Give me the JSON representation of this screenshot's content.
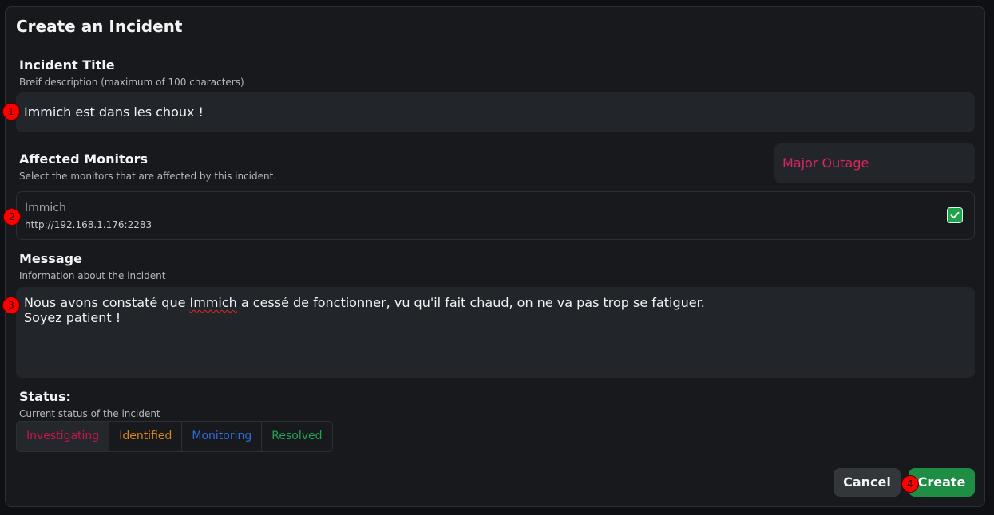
{
  "dialog": {
    "title": "Create an Incident"
  },
  "incident_title": {
    "label": "Incident Title",
    "hint": "Breif description (maximum of 100 characters)",
    "value": "Immich est dans les choux !"
  },
  "monitors": {
    "label": "Affected Monitors",
    "hint": "Select the monitors that are affected by this incident.",
    "impact_value": "Major Outage",
    "items": [
      {
        "name": "Immich",
        "url": "http://192.168.1.176:2283",
        "checked": true
      }
    ]
  },
  "message": {
    "label": "Message",
    "hint": "Information about the incident",
    "line1_before": "Nous avons constaté que ",
    "line1_misspelled": "Immich",
    "line1_after": " a cessé de fonctionner, vu qu'il fait chaud, on ne va pas trop se fatiguer.",
    "line2": "Soyez patient !"
  },
  "status": {
    "label": "Status:",
    "hint": "Current status of the incident",
    "options": [
      {
        "label": "Investigating",
        "color": "#c7174b",
        "selected": true
      },
      {
        "label": "Identified",
        "color": "#d9861a",
        "selected": false
      },
      {
        "label": "Monitoring",
        "color": "#2f6fdc",
        "selected": false
      },
      {
        "label": "Resolved",
        "color": "#22a355",
        "selected": false
      }
    ]
  },
  "actions": {
    "cancel": "Cancel",
    "create": "Create"
  },
  "markers": [
    "1",
    "2",
    "3",
    "4"
  ],
  "colors": {
    "accent_green": "#1f8e45",
    "outage_pink": "#e0245e",
    "panel_bg": "#17191c",
    "input_bg": "#22262a"
  }
}
